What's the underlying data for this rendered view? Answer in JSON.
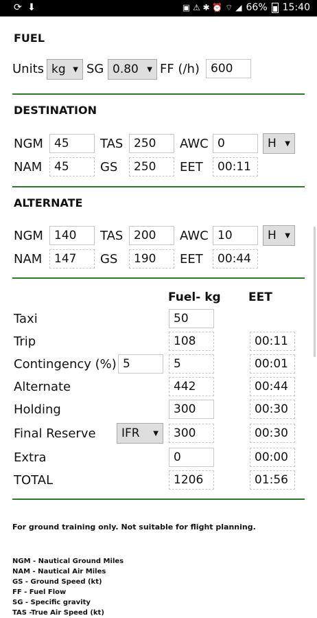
{
  "status": {
    "left_icons": "⟳ ⬇",
    "battery": "66%",
    "time": "15:40"
  },
  "fuel": {
    "header": "FUEL",
    "units_label": "Units",
    "units_value": "kg",
    "sg_label": "SG",
    "sg_value": "0.80",
    "ff_label": "FF (/h)",
    "ff_value": "600"
  },
  "destination": {
    "header": "DESTINATION",
    "ngm_label": "NGM",
    "ngm": "45",
    "tas_label": "TAS",
    "tas": "250",
    "awc_label": "AWC",
    "awc": "0",
    "hw": "H",
    "nam_label": "NAM",
    "nam": "45",
    "gs_label": "GS",
    "gs": "250",
    "eet_label": "EET",
    "eet": "00:11"
  },
  "alternate": {
    "header": "ALTERNATE",
    "ngm_label": "NGM",
    "ngm": "140",
    "tas_label": "TAS",
    "tas": "200",
    "awc_label": "AWC",
    "awc": "10",
    "hw": "H",
    "nam_label": "NAM",
    "nam": "147",
    "gs_label": "GS",
    "gs": "190",
    "eet_label": "EET",
    "eet": "00:44"
  },
  "table": {
    "col_fuel": "Fuel- kg",
    "col_eet": "EET",
    "taxi": {
      "label": "Taxi",
      "fuel": "50"
    },
    "trip": {
      "label": "Trip",
      "fuel": "108",
      "eet": "00:11"
    },
    "contingency": {
      "label": "Contingency (%)",
      "pct": "5",
      "fuel": "5",
      "eet": "00:01"
    },
    "alternate": {
      "label": "Alternate",
      "fuel": "442",
      "eet": "00:44"
    },
    "holding": {
      "label": "Holding",
      "fuel": "300",
      "eet": "00:30"
    },
    "final_reserve": {
      "label": "Final Reserve",
      "rule": "IFR",
      "fuel": "300",
      "eet": "00:30"
    },
    "extra": {
      "label": "Extra",
      "fuel": "0",
      "eet": "00:00"
    },
    "total": {
      "label": "TOTAL",
      "fuel": "1206",
      "eet": "01:56"
    }
  },
  "disclaimer": "For ground training only. Not suitable for flight planning.",
  "legend": [
    "NGM - Nautical Ground Miles",
    "NAM - Nautical Air Miles",
    "GS - Ground Speed (kt)",
    "FF - Fuel Flow",
    "SG - Specific gravity",
    "TAS -True Air Speed (kt)"
  ]
}
